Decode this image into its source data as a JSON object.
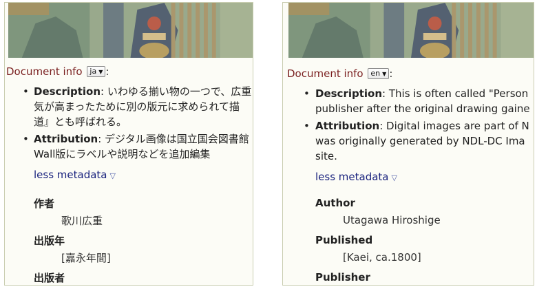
{
  "panels": {
    "ja": {
      "docinfo_label": "Document info",
      "lang_value": "ja",
      "metadata": [
        {
          "key": "Description",
          "sep": ": ",
          "lines": [
            "いわゆる揃い物の一つで、広重",
            "気が高まったために別の版元に求められて描",
            "道』とも呼ばれる。"
          ]
        },
        {
          "key": "Attribution",
          "sep": ": ",
          "lines": [
            "デジタル画像は国立国会図書館",
            "Wall版にラベルや説明などを追加編集"
          ]
        }
      ],
      "less_label": "less metadata",
      "fields": [
        {
          "label": "作者",
          "value": "歌川広重"
        },
        {
          "label": "出版年",
          "value": "[嘉永年間]"
        },
        {
          "label": "出版者",
          "value": ""
        }
      ]
    },
    "en": {
      "docinfo_label": "Document info",
      "lang_value": "en",
      "metadata": [
        {
          "key": "Description",
          "sep": ": ",
          "lines": [
            "This is often called \"Person",
            "publisher after the original drawing gaine"
          ]
        },
        {
          "key": "Attribution",
          "sep": ": ",
          "lines": [
            "Digital images are part of N",
            "was originally generated by NDL-DC Ima",
            "site."
          ]
        }
      ],
      "less_label": "less metadata",
      "fields": [
        {
          "label": "Author",
          "value": "Utagawa Hiroshige"
        },
        {
          "label": "Published",
          "value": "[Kaei, ca.1800]"
        },
        {
          "label": "Publisher",
          "value": ""
        }
      ]
    }
  },
  "icons": {
    "bullet": "•",
    "select_caret": "▼",
    "less_triangle": "▽"
  },
  "colors": {
    "docinfo_label": "#7a1f1f",
    "link": "#1a237e",
    "panel_background": "#fcfcf6"
  }
}
